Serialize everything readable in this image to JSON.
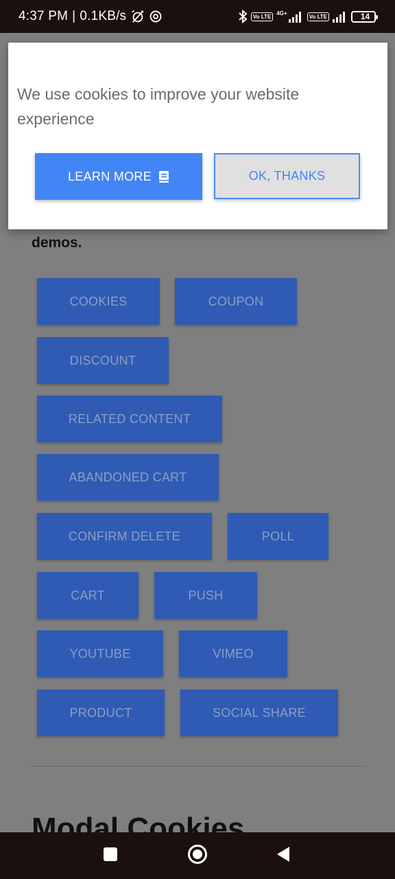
{
  "status_bar": {
    "time": "4:37 PM",
    "separator": "|",
    "speed": "0.1KB/s",
    "volte1": "Vo LTE",
    "net_tag": "4G+",
    "volte2": "Vo LTE",
    "battery": "14"
  },
  "page": {
    "demos_text": "demos.",
    "buttons": [
      {
        "label": "COOKIES"
      },
      {
        "label": "COUPON"
      },
      {
        "label": "DISCOUNT"
      },
      {
        "label": "RELATED CONTENT"
      },
      {
        "label": "ABANDONED CART"
      },
      {
        "label": "CONFIRM DELETE"
      },
      {
        "label": "POLL"
      },
      {
        "label": "CART"
      },
      {
        "label": "PUSH"
      },
      {
        "label": "YOUTUBE"
      },
      {
        "label": "VIMEO"
      },
      {
        "label": "PRODUCT"
      },
      {
        "label": "SOCIAL SHARE"
      }
    ],
    "section_heading": "Modal Cookies"
  },
  "cookie_modal": {
    "message": "We use cookies to improve your website experience",
    "learn_more_label": "LEARN MORE",
    "learn_more_icon": "book-icon",
    "ok_label": "OK, THANKS"
  },
  "colors": {
    "accent": "#4285f4",
    "demo_button": "#2f5bb5",
    "overlay": "#7f7f7f",
    "system_bar": "#1b100e"
  }
}
